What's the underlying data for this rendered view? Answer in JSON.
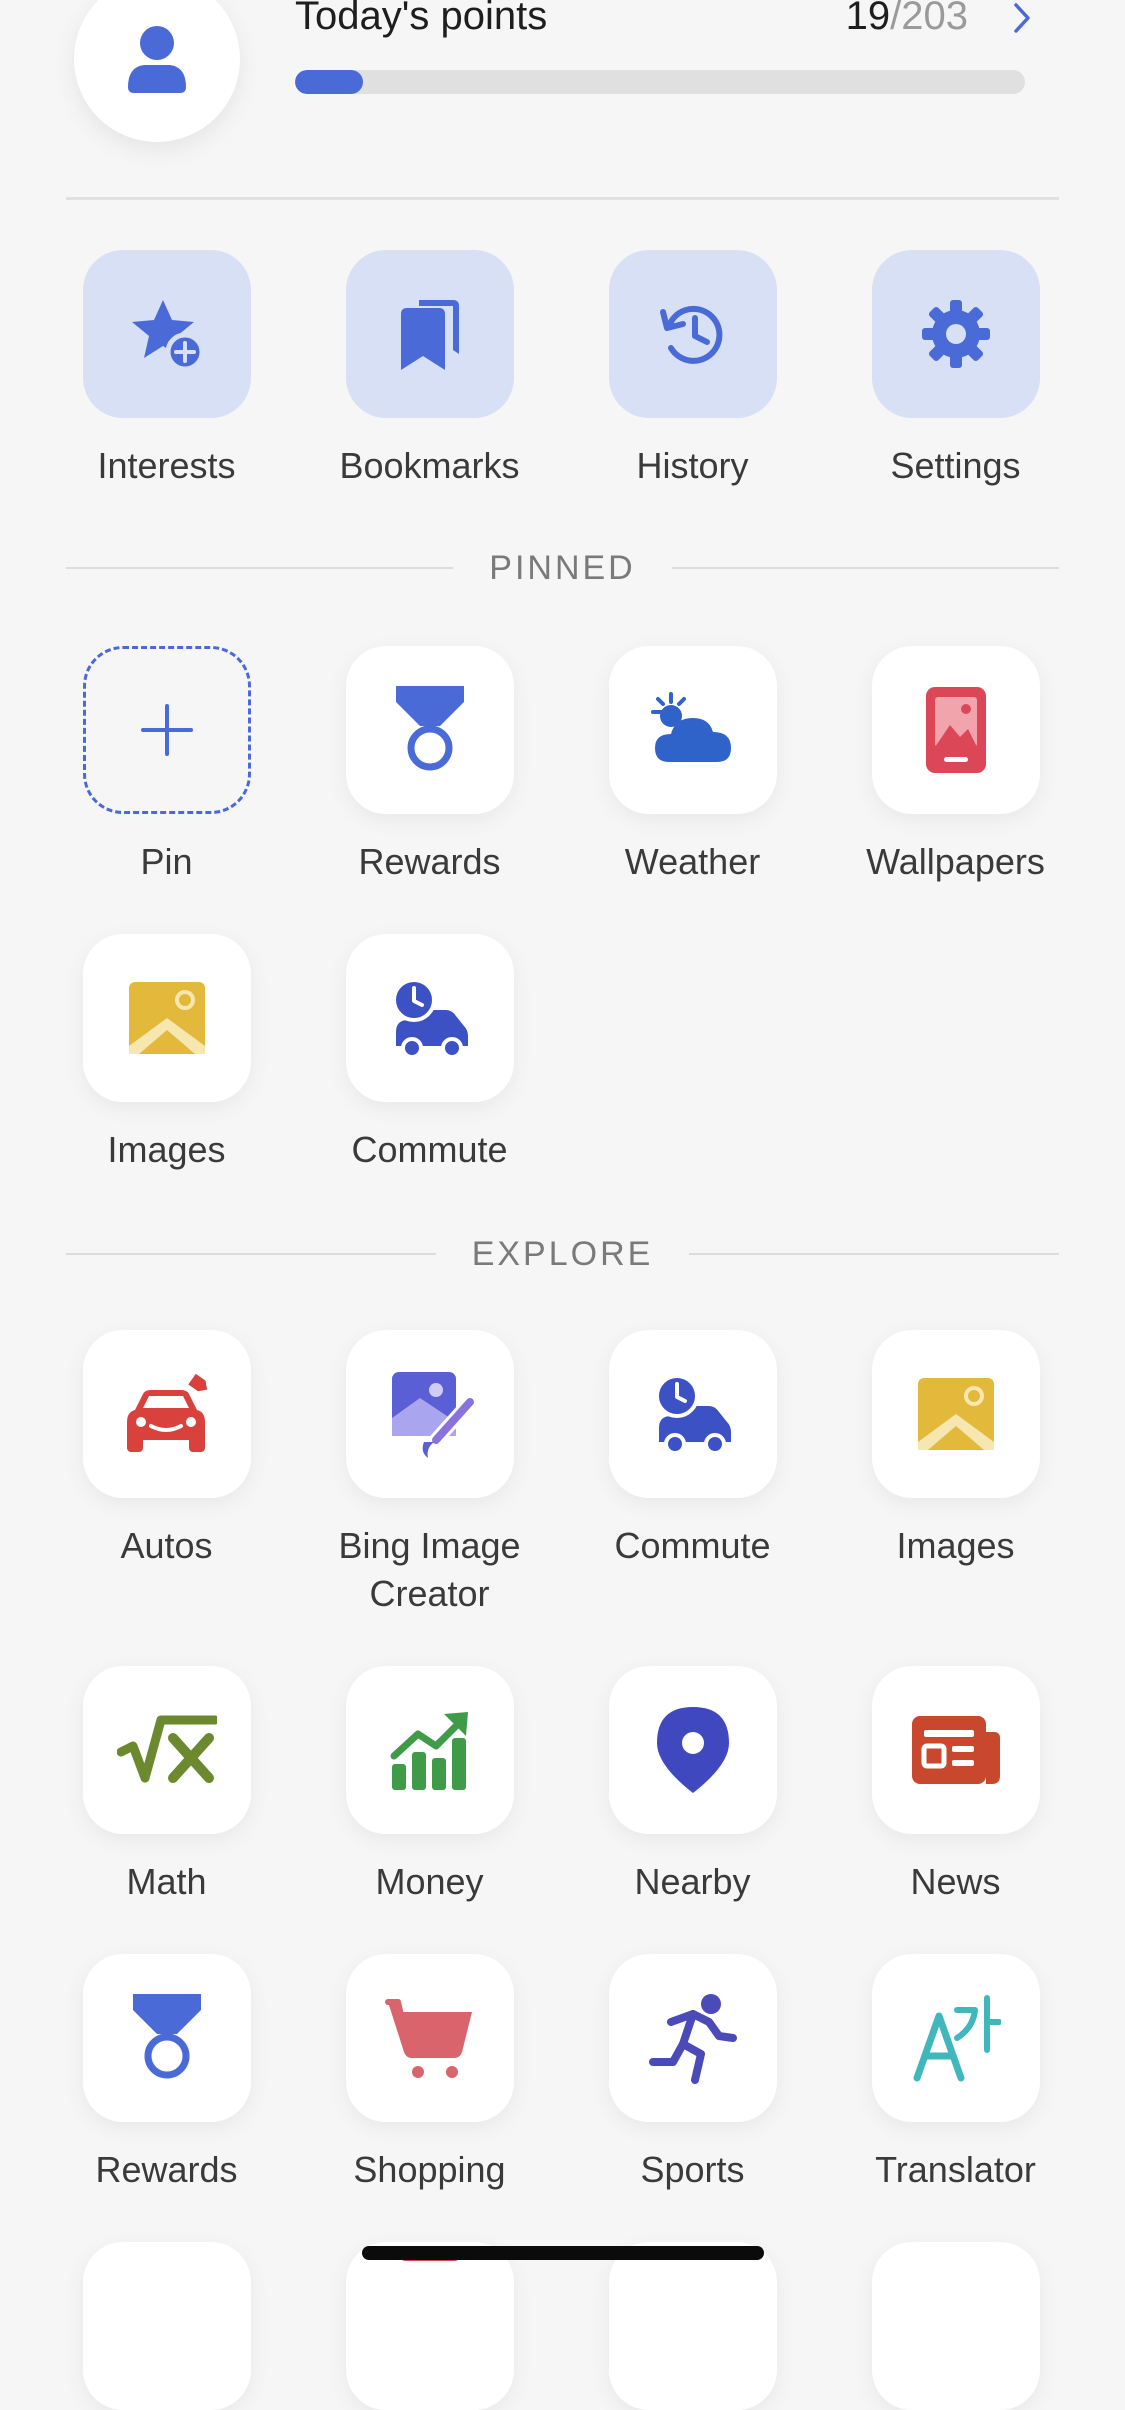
{
  "header": {
    "title": "Today's points",
    "points_current": "19",
    "points_separator": "/",
    "points_total": "203",
    "progress_fraction": 0.0936
  },
  "quick_actions": [
    {
      "label": "Interests",
      "icon": "star-add-icon"
    },
    {
      "label": "Bookmarks",
      "icon": "bookmarks-icon"
    },
    {
      "label": "History",
      "icon": "history-icon"
    },
    {
      "label": "Settings",
      "icon": "gear-icon"
    }
  ],
  "pinned": {
    "title": "PINNED",
    "items": [
      {
        "label": "Pin",
        "icon": "plus-icon"
      },
      {
        "label": "Rewards",
        "icon": "medal-icon"
      },
      {
        "label": "Weather",
        "icon": "weather-icon"
      },
      {
        "label": "Wallpapers",
        "icon": "wallpaper-icon"
      },
      {
        "label": "Images",
        "icon": "image-icon"
      },
      {
        "label": "Commute",
        "icon": "commute-icon"
      }
    ]
  },
  "explore": {
    "title": "EXPLORE",
    "items": [
      {
        "label": "Autos",
        "icon": "car-icon"
      },
      {
        "label": "Bing Image\nCreator",
        "icon": "image-creator-icon"
      },
      {
        "label": "Commute",
        "icon": "commute-icon"
      },
      {
        "label": "Images",
        "icon": "image-icon"
      },
      {
        "label": "Math",
        "icon": "math-icon"
      },
      {
        "label": "Money",
        "icon": "money-chart-icon"
      },
      {
        "label": "Nearby",
        "icon": "location-pin-icon"
      },
      {
        "label": "News",
        "icon": "news-icon"
      },
      {
        "label": "Rewards",
        "icon": "medal-icon"
      },
      {
        "label": "Shopping",
        "icon": "shopping-cart-icon"
      },
      {
        "label": "Sports",
        "icon": "runner-icon"
      },
      {
        "label": "Translator",
        "icon": "translator-icon"
      }
    ]
  },
  "colors": {
    "accent": "#4a6ad7",
    "tile_tint": "#d8e0f6",
    "autos": "#d9413c",
    "images": "#e2b93b",
    "math": "#6b8a2f",
    "money": "#3f9b47",
    "nearby": "#4048c0",
    "news": "#c9472c",
    "shopping": "#d9646c",
    "translator": "#3fb7bd",
    "wallpapers": "#dc4757"
  }
}
